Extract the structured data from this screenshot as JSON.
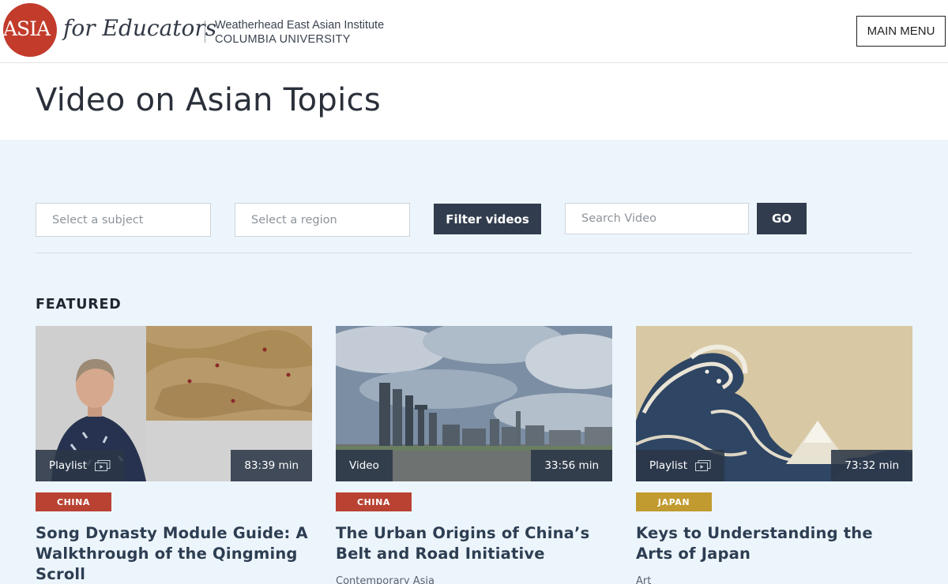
{
  "header": {
    "logo_asia": "ASIA",
    "logo_for_educators": "for Educators",
    "institute_line1": "Weatherhead East Asian Institute",
    "institute_line2": "COLUMBIA UNIVERSITY",
    "main_menu_label": "MAIN MENU"
  },
  "page": {
    "title": "Video on Asian Topics"
  },
  "filters": {
    "subject_placeholder": "Select a subject",
    "region_placeholder": "Select a region",
    "filter_button_label": "Filter videos",
    "search_placeholder": "Search Video",
    "go_button_label": "GO"
  },
  "featured": {
    "heading": "FEATURED",
    "cards": [
      {
        "type": "Playlist",
        "duration": "83:39 min",
        "region": "CHINA",
        "title": "Song Dynasty Module Guide: A Walkthrough of the Qingming Scroll",
        "subject": ""
      },
      {
        "type": "Video",
        "duration": "33:56 min",
        "region": "CHINA",
        "title": "The Urban Origins of China’s Belt and Road Initiative",
        "subject": "Contemporary Asia"
      },
      {
        "type": "Playlist",
        "duration": "73:32 min",
        "region": "JAPAN",
        "title": "Keys to Understanding the Arts of Japan",
        "subject": "Art"
      }
    ]
  },
  "colors": {
    "brand_red": "#c23b2b",
    "dark_navy": "#313d4e",
    "section_bg": "#edf5fc",
    "tag_china": "#b94232",
    "tag_japan": "#c19b2f"
  }
}
